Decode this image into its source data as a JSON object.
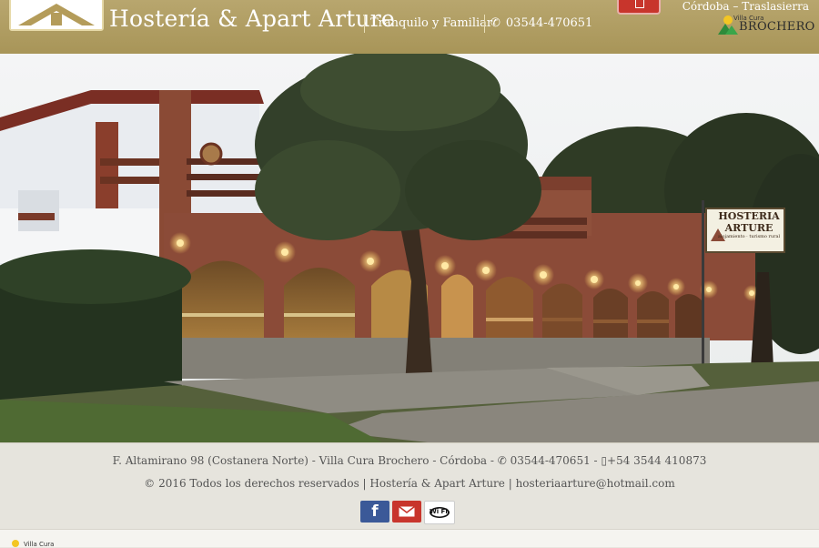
{
  "header": {
    "title": "Hostería & Apart Arture",
    "tagline": "Tranquilo y Familiar",
    "phone": "03544-470651",
    "region": "Córdoba – Traslasierra",
    "partner_logo_small": "Villa Cura",
    "partner_logo_big": "BROCHERO",
    "logo_icon": "house-roof-logo-icon",
    "phone_icon": "phone-icon"
  },
  "hero": {
    "sign_line1": "HOSTERIA",
    "sign_line2": "ARTURE",
    "sign_line3": "alojamiento · turismo rural"
  },
  "footer": {
    "address": "F. Altamirano 98 (Costanera Norte) - Villa Cura Brochero - Córdoba -",
    "phone_1": "03544-470651",
    "phone_2": "+54 3544 410873",
    "copyright": "© 2016 Todos los derechos reservados | Hostería & Apart Arture | hosteriaarture@hotmail.com",
    "social": [
      {
        "name": "facebook-icon",
        "label": "f"
      },
      {
        "name": "mail-icon"
      },
      {
        "name": "wifi-icon",
        "label": "Wi Fi"
      }
    ],
    "bottom_logo": "Villa Cura"
  },
  "colors": {
    "header_bg": "#a89558",
    "facebook": "#3b5998",
    "mail": "#c8352c"
  }
}
